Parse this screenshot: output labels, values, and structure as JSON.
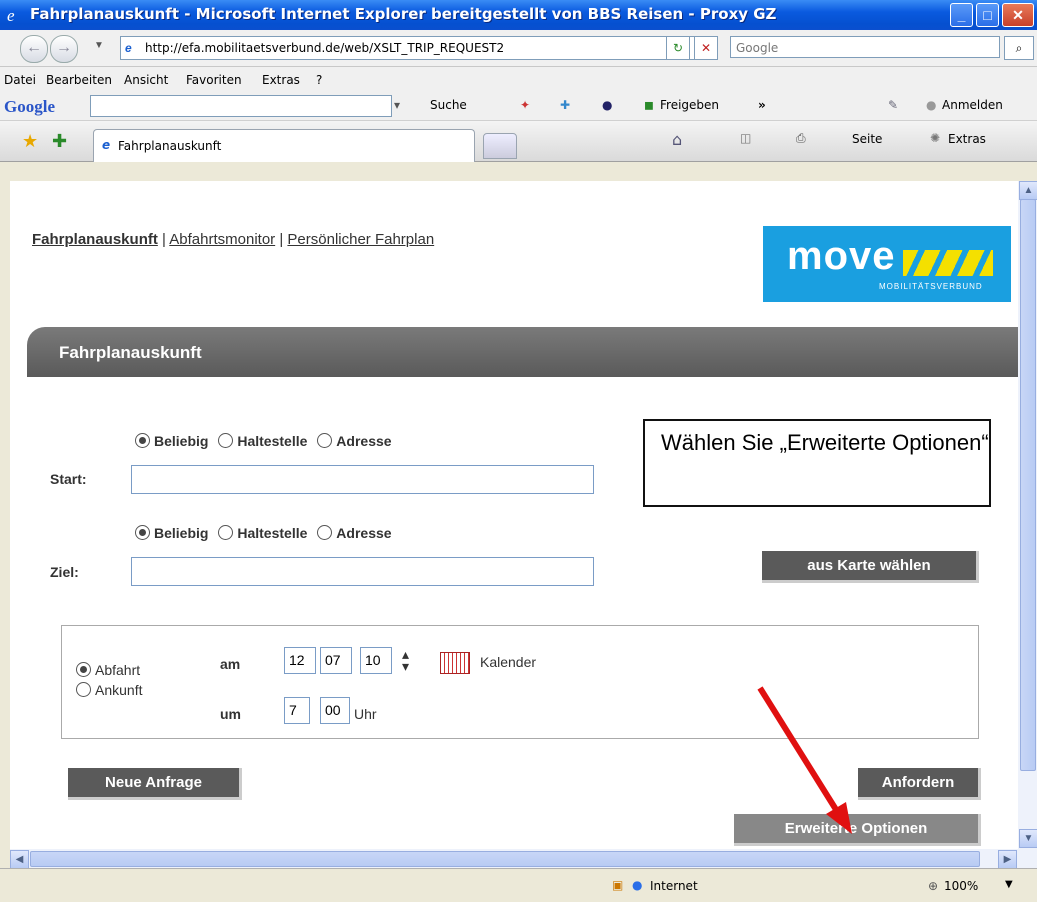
{
  "window": {
    "title": "Fahrplanauskunft - Microsoft Internet Explorer bereitgestellt von BBS Reisen - Proxy GZ"
  },
  "addressbar": {
    "url": "http://efa.mobilitaetsverbund.de/web/XSLT_TRIP_REQUEST2",
    "search_placeholder": "Google"
  },
  "menu": [
    "Datei",
    "Bearbeiten",
    "Ansicht",
    "Favoriten",
    "Extras",
    "?"
  ],
  "google_toolbar": {
    "logo": "Google",
    "suche": "Suche",
    "freigeben": "Freigeben",
    "more": "»",
    "anmelden": "Anmelden"
  },
  "tabs": {
    "active_label": "Fahrplanauskunft",
    "seite": "Seite",
    "extras": "Extras"
  },
  "page": {
    "links": [
      "Fahrplanauskunft",
      "Abfahrtsmonitor",
      "Persönlicher Fahrplan"
    ],
    "logo_text": "move",
    "logo_sub": "MOBILITÄTSVERBUND",
    "panel_title": "Fahrplanauskunft",
    "radio_options": [
      "Beliebig",
      "Haltestelle",
      "Adresse"
    ],
    "start_label": "Start:",
    "ziel_label": "Ziel:",
    "map_button": "aus Karte wählen",
    "abfahrt": "Abfahrt",
    "ankunft": "Ankunft",
    "am": "am",
    "um": "um",
    "day": "12",
    "month": "07",
    "year": "10",
    "kalender": "Kalender",
    "hour": "7",
    "minute": "00",
    "uhr": "Uhr",
    "neue_anfrage": "Neue Anfrage",
    "anfordern": "Anfordern",
    "erweiterte": "Erweiterte Optionen"
  },
  "callout": {
    "text": "Wählen Sie „Erweiterte Optionen“"
  },
  "status": {
    "zone": "Internet",
    "zoom": "100%"
  }
}
